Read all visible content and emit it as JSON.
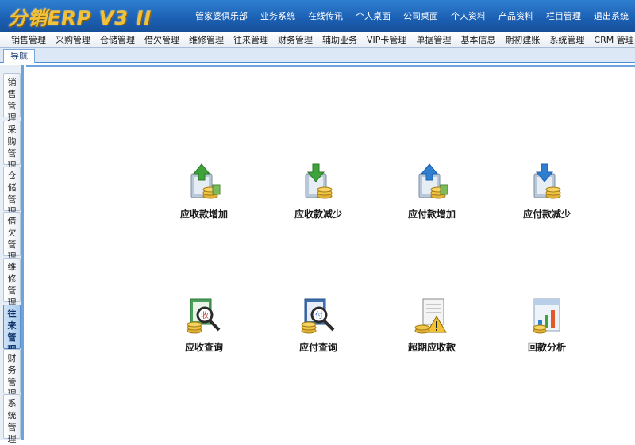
{
  "header": {
    "logo": "分销ERP V3 II",
    "nav": [
      "管家婆俱乐部",
      "业务系统",
      "在线传讯",
      "个人桌面",
      "公司桌面",
      "个人资料",
      "产品资料",
      "栏目管理",
      "退出系统"
    ]
  },
  "menubar": [
    "销售管理",
    "采购管理",
    "仓储管理",
    "借欠管理",
    "维修管理",
    "往来管理",
    "财务管理",
    "辅助业务",
    "VIP卡管理",
    "单据管理",
    "基本信息",
    "期初建账",
    "系统管理",
    "CRM 管理"
  ],
  "tabs": [
    "导航"
  ],
  "sidebar": [
    "销售管理",
    "采购管理",
    "仓储管理",
    "借欠管理",
    "维修管理",
    "往来管理",
    "财务管理",
    "系统管理"
  ],
  "tiles": [
    {
      "label": "应收款增加",
      "icon": "receivable-increase-icon"
    },
    {
      "label": "应收款减少",
      "icon": "receivable-decrease-icon"
    },
    {
      "label": "应付款增加",
      "icon": "payable-increase-icon"
    },
    {
      "label": "应付款减少",
      "icon": "payable-decrease-icon"
    },
    {
      "label": "应收查询",
      "icon": "receivable-query-icon"
    },
    {
      "label": "应付查询",
      "icon": "payable-query-icon"
    },
    {
      "label": "超期应收款",
      "icon": "overdue-receivable-icon"
    },
    {
      "label": "回款分析",
      "icon": "payment-analysis-icon"
    }
  ],
  "colors": {
    "accent": "#1b5fb3",
    "tab_border": "#4a8ed8",
    "logo_gold": "#f2c13a"
  }
}
